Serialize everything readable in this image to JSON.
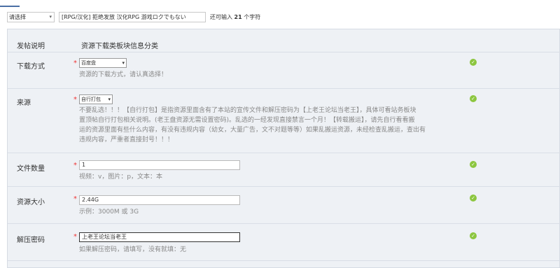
{
  "topbar": {
    "type_value": "请选择",
    "title_value": "[RPG/汉化] 拒绝发放 汉化RPG 游戏ロクでもない",
    "char_hint_prefix": "还可输入",
    "char_count": "21",
    "char_hint_suffix": "个字符"
  },
  "section": {
    "header_label": "发帖说明",
    "header_value": "资源下载类板块信息分类"
  },
  "fields": {
    "download": {
      "label": "下载方式",
      "value": "百度盘",
      "hint": "资源的下载方式，请认真选择！"
    },
    "source": {
      "label": "来源",
      "value": "自行打包",
      "hint_lines": [
        "不要乱选！！！【自行打包】是指资源里面含有了本站的宣传文件和解压密码为【上老王论坛当老王】，具体可看站务板块",
        "置顶帖自行打包相关说明。(老王盘资源无需设置密码)。乱选的一经发现直接禁言一个月！【转载搬运】，请先自行看看搬",
        "运的资源里面有些什么内容，有没有违规内容（幼女，大量广告，文不对题等等）如果乱搬运资源，未经检查乱搬运，查出有",
        "违规内容，严重者直接封号！！！"
      ]
    },
    "file_count": {
      "label": "文件数量",
      "value": "1",
      "hint": "视频：v，图片：p，文本：本"
    },
    "size": {
      "label": "资源大小",
      "value": "2.44G",
      "hint": "示例：3000M 或 3G"
    },
    "password": {
      "label": "解压密码",
      "value": "上老王论坛当老王",
      "hint": "如果解压密码，请填写，没有就填：无"
    }
  },
  "icons": {
    "required_mark": "*",
    "ok_icon": "check-circle"
  },
  "colors": {
    "required": "#e33333",
    "ok": "#8cc63f",
    "panel_bg": "#eef1f5"
  }
}
